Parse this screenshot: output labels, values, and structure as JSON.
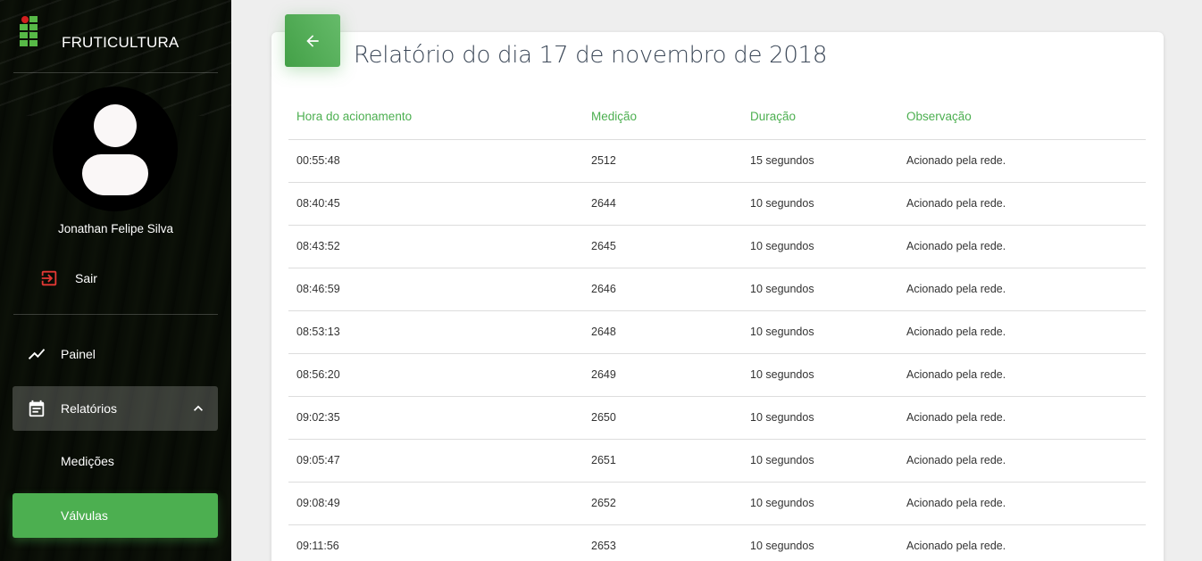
{
  "brand": {
    "name": "FRUTICULTURA"
  },
  "user": {
    "name": "Jonathan Felipe Silva"
  },
  "logout": {
    "label": "Sair"
  },
  "nav": {
    "painel": "Painel",
    "relatorios": "Relatórios",
    "medicoes": "Medições",
    "valvulas": "Válvulas"
  },
  "colors": {
    "accent": "#4caf50",
    "logout_icon": "#e53935",
    "logo_dot": "#d21f1f"
  },
  "icons": {
    "back": "arrow-left-icon",
    "logout": "exit-icon",
    "painel": "trending-icon",
    "relatorios": "calendar-icon",
    "chevron": "chevron-up-icon"
  },
  "report": {
    "title": "Relatório do dia 17 de novembro de 2018",
    "columns": [
      "Hora do acionamento",
      "Medição",
      "Duração",
      "Observação"
    ],
    "rows": [
      [
        "00:55:48",
        "2512",
        "15 segundos",
        "Acionado pela rede."
      ],
      [
        "08:40:45",
        "2644",
        "10 segundos",
        "Acionado pela rede."
      ],
      [
        "08:43:52",
        "2645",
        "10 segundos",
        "Acionado pela rede."
      ],
      [
        "08:46:59",
        "2646",
        "10 segundos",
        "Acionado pela rede."
      ],
      [
        "08:53:13",
        "2648",
        "10 segundos",
        "Acionado pela rede."
      ],
      [
        "08:56:20",
        "2649",
        "10 segundos",
        "Acionado pela rede."
      ],
      [
        "09:02:35",
        "2650",
        "10 segundos",
        "Acionado pela rede."
      ],
      [
        "09:05:47",
        "2651",
        "10 segundos",
        "Acionado pela rede."
      ],
      [
        "09:08:49",
        "2652",
        "10 segundos",
        "Acionado pela rede."
      ],
      [
        "09:11:56",
        "2653",
        "10 segundos",
        "Acionado pela rede."
      ]
    ]
  }
}
